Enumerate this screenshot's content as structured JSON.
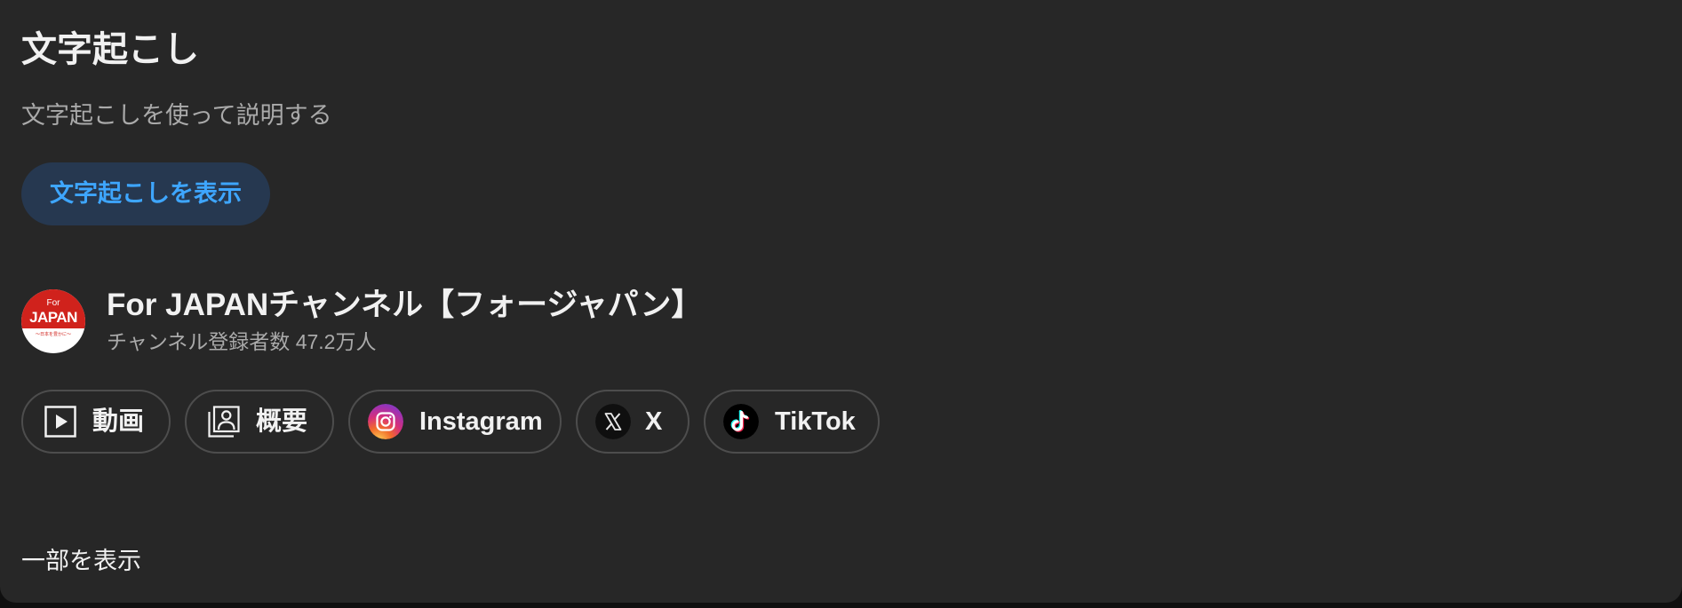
{
  "transcript": {
    "title": "文字起こし",
    "description": "文字起こしを使って説明する",
    "show_button_label": "文字起こしを表示"
  },
  "channel": {
    "avatar_text_small": "For",
    "avatar_text_large": "JAPAN",
    "avatar_tagline": "〜日本を豊かに〜",
    "name": "For JAPANチャンネル【フォージャパン】",
    "subscribers": "チャンネル登録者数 47.2万人"
  },
  "links": [
    {
      "label": "動画",
      "icon": "video-play-icon"
    },
    {
      "label": "概要",
      "icon": "about-person-icon"
    },
    {
      "label": "Instagram",
      "icon": "instagram-icon"
    },
    {
      "label": "X",
      "icon": "x-logo-icon"
    },
    {
      "label": "TikTok",
      "icon": "tiktok-icon"
    }
  ],
  "footer": {
    "show_less_label": "一部を表示"
  },
  "colors": {
    "panel_bg": "#272727",
    "page_bg": "#0f0f0f",
    "accent_text": "#3ea6ff",
    "accent_bg": "#263850",
    "secondary_text": "#aaaaaa",
    "chip_border": "#4d4d4d"
  }
}
